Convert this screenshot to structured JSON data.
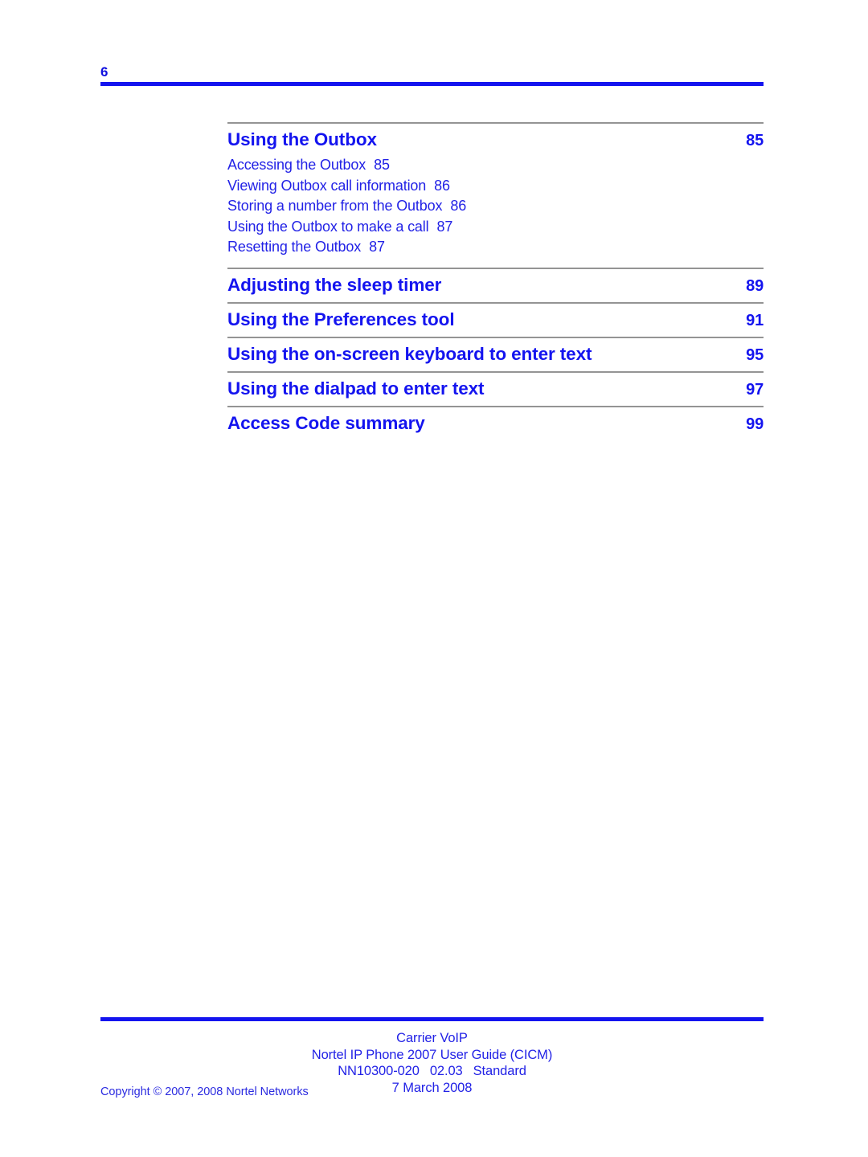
{
  "header": {
    "folio": "6"
  },
  "toc": {
    "entries": [
      {
        "title": "Using the Outbox",
        "page": "85",
        "subentries": [
          {
            "title": "Accessing the Outbox",
            "page": "85"
          },
          {
            "title": "Viewing Outbox call information",
            "page": "86"
          },
          {
            "title": "Storing a number from the Outbox",
            "page": "86"
          },
          {
            "title": "Using the Outbox to make a call",
            "page": "87"
          },
          {
            "title": "Resetting the Outbox",
            "page": "87"
          }
        ]
      },
      {
        "title": "Adjusting the sleep timer",
        "page": "89",
        "subentries": []
      },
      {
        "title": "Using the Preferences tool",
        "page": "91",
        "subentries": []
      },
      {
        "title": "Using the on-screen keyboard to enter text",
        "page": "95",
        "subentries": []
      },
      {
        "title": "Using the dialpad to enter text",
        "page": "97",
        "subentries": []
      },
      {
        "title": "Access Code summary",
        "page": "99",
        "subentries": []
      }
    ]
  },
  "footer": {
    "line1": "Carrier VoIP",
    "line2": "Nortel IP Phone 2007 User Guide (CICM)",
    "doc_number": "NN10300-020",
    "doc_version": "02.03",
    "doc_status": "Standard",
    "date": "7 March 2008",
    "copyright_word": "Copyright",
    "copyright_symbol": "©",
    "copyright_years": "2007, 2008",
    "copyright_owner": "Nortel Networks"
  },
  "colors": {
    "accent_blue": "#1414ef",
    "text_blue": "#2222e6",
    "rule_gray": "#949494"
  }
}
